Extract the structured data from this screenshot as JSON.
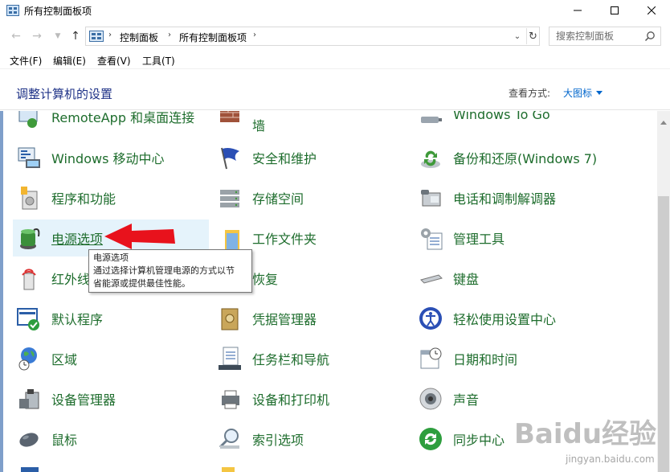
{
  "window": {
    "title": "所有控制面板项"
  },
  "address": {
    "crumbs": [
      "控制面板",
      "所有控制面板项"
    ],
    "search_placeholder": "搜索控制面板"
  },
  "menu": [
    "文件(F)",
    "编辑(E)",
    "查看(V)",
    "工具(T)"
  ],
  "header": {
    "heading": "调整计算机的设置",
    "view_by_label": "查看方式:",
    "view_by_value": "大图标"
  },
  "items": [
    {
      "label": "RemoteApp 和桌面连接",
      "icon": "remoteapp-icon"
    },
    {
      "label": "墙",
      "icon": "firewall-icon"
    },
    {
      "label": "Windows To Go",
      "icon": "usb-drive-icon"
    },
    {
      "label": "Windows 移动中心",
      "icon": "mobility-center-icon"
    },
    {
      "label": "安全和维护",
      "icon": "flag-icon"
    },
    {
      "label": "备份和还原(Windows 7)",
      "icon": "backup-icon"
    },
    {
      "label": "程序和功能",
      "icon": "programs-icon"
    },
    {
      "label": "存储空间",
      "icon": "storage-icon"
    },
    {
      "label": "电话和调制解调器",
      "icon": "phone-icon"
    },
    {
      "label": "电源选项",
      "icon": "battery-icon"
    },
    {
      "label": "工作文件夹",
      "icon": "folder-icon"
    },
    {
      "label": "管理工具",
      "icon": "admin-tools-icon"
    },
    {
      "label": "红外线",
      "icon": "infrared-icon"
    },
    {
      "label": "恢复",
      "icon": "recovery-icon"
    },
    {
      "label": "键盘",
      "icon": "keyboard-icon"
    },
    {
      "label": "默认程序",
      "icon": "default-programs-icon"
    },
    {
      "label": "凭据管理器",
      "icon": "credential-icon"
    },
    {
      "label": "轻松使用设置中心",
      "icon": "ease-of-access-icon"
    },
    {
      "label": "区域",
      "icon": "globe-clock-icon"
    },
    {
      "label": "任务栏和导航",
      "icon": "taskbar-icon"
    },
    {
      "label": "日期和时间",
      "icon": "calendar-clock-icon"
    },
    {
      "label": "设备管理器",
      "icon": "device-manager-icon"
    },
    {
      "label": "设备和打印机",
      "icon": "printer-icon"
    },
    {
      "label": "声音",
      "icon": "speaker-icon"
    },
    {
      "label": "鼠标",
      "icon": "mouse-icon"
    },
    {
      "label": "索引选项",
      "icon": "magnifier-icon"
    },
    {
      "label": "同步中心",
      "icon": "sync-icon"
    }
  ],
  "tooltip": {
    "title": "电源选项",
    "line1": "通过选择计算机管理电源的方式以节",
    "line2": "省能源或提供最佳性能。"
  },
  "watermark": {
    "logo": "Baidu经验",
    "url": "jingyan.baidu.com"
  }
}
